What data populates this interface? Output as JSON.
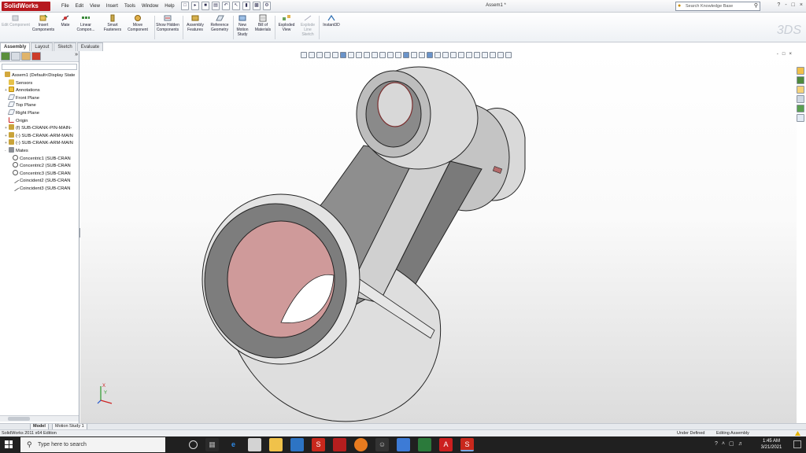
{
  "app": {
    "logo_text": "SolidWorks",
    "document_title": "Assem1 *"
  },
  "menu": [
    "File",
    "Edit",
    "View",
    "Insert",
    "Tools",
    "Window",
    "Help"
  ],
  "search": {
    "placeholder": "Search Knowledge Base"
  },
  "window_controls": [
    "?",
    "-",
    "□",
    "×"
  ],
  "commands": [
    {
      "label": "Edit Component",
      "icon": "edit-component-icon",
      "enabled": false
    },
    {
      "label": "Insert Components",
      "icon": "insert-components-icon",
      "enabled": true
    },
    {
      "label": "Mate",
      "icon": "mate-icon",
      "enabled": true
    },
    {
      "label": "Linear Compon...",
      "icon": "linear-pattern-icon",
      "enabled": true
    },
    {
      "label": "Smart Fasteners",
      "icon": "smart-fasteners-icon",
      "enabled": true
    },
    {
      "label": "Move Component",
      "icon": "move-component-icon",
      "enabled": true
    },
    {
      "label": "Show Hidden Components",
      "icon": "show-hidden-icon",
      "enabled": true
    },
    {
      "label": "Assembly Features",
      "icon": "assembly-features-icon",
      "enabled": true
    },
    {
      "label": "Reference Geometry",
      "icon": "reference-geometry-icon",
      "enabled": true
    },
    {
      "label": "New Motion Study",
      "icon": "motion-study-icon",
      "enabled": true
    },
    {
      "label": "Bill of Materials",
      "icon": "bom-icon",
      "enabled": true
    },
    {
      "label": "Exploded View",
      "icon": "exploded-view-icon",
      "enabled": true
    },
    {
      "label": "Explode Line Sketch",
      "icon": "explode-line-icon",
      "enabled": false
    },
    {
      "label": "Instant3D",
      "icon": "instant3d-icon",
      "enabled": true
    }
  ],
  "cm_tabs": [
    "Assembly",
    "Layout",
    "Sketch",
    "Evaluate"
  ],
  "tree": [
    {
      "label": "Assem1  (Default<Display State",
      "icon": "asm",
      "indent": 0,
      "exp": ""
    },
    {
      "label": "Sensors",
      "icon": "sens",
      "indent": 1,
      "exp": ""
    },
    {
      "label": "Annotations",
      "icon": "ann",
      "indent": 1,
      "exp": "+"
    },
    {
      "label": "Front Plane",
      "icon": "plane",
      "indent": 1,
      "exp": ""
    },
    {
      "label": "Top Plane",
      "icon": "plane",
      "indent": 1,
      "exp": ""
    },
    {
      "label": "Right Plane",
      "icon": "plane",
      "indent": 1,
      "exp": ""
    },
    {
      "label": "Origin",
      "icon": "origin",
      "indent": 1,
      "exp": ""
    },
    {
      "label": "(f) SUB-CRANK-PIN-MAIN-",
      "icon": "sub",
      "indent": 1,
      "exp": "+"
    },
    {
      "label": "(-) SUB-CRANK-ARM-MAIN",
      "icon": "sub",
      "indent": 1,
      "exp": "+"
    },
    {
      "label": "(-) SUB-CRANK-ARM-MAIN",
      "icon": "sub",
      "indent": 1,
      "exp": "+"
    },
    {
      "label": "Mates",
      "icon": "mates",
      "indent": 1,
      "exp": "-"
    },
    {
      "label": "Concentric1 (SUB-CRAN",
      "icon": "conc",
      "indent": 2,
      "exp": ""
    },
    {
      "label": "Concentric2 (SUB-CRAN",
      "icon": "conc",
      "indent": 2,
      "exp": ""
    },
    {
      "label": "Concentric3 (SUB-CRAN",
      "icon": "conc",
      "indent": 2,
      "exp": ""
    },
    {
      "label": "Coincident2 (SUB-CRAN",
      "icon": "coinc",
      "indent": 2,
      "exp": ""
    },
    {
      "label": "Coincident3 (SUB-CRAN",
      "icon": "coinc",
      "indent": 2,
      "exp": ""
    }
  ],
  "model_tabs": [
    "Model",
    "Motion Study 1"
  ],
  "status": {
    "left": "SolidWorks 2011 x64 Edition",
    "middle": "Under Defined",
    "right": "Editing Assembly"
  },
  "taskbar": {
    "search_placeholder": "Type here to search",
    "time": "1:45 AM",
    "date": "3/21/2021"
  },
  "colors": {
    "brand": "#b6181e",
    "model_face": "#c8c8c8",
    "bore": "#d69a9a"
  },
  "triad": {
    "x": "X",
    "y": "Y"
  }
}
